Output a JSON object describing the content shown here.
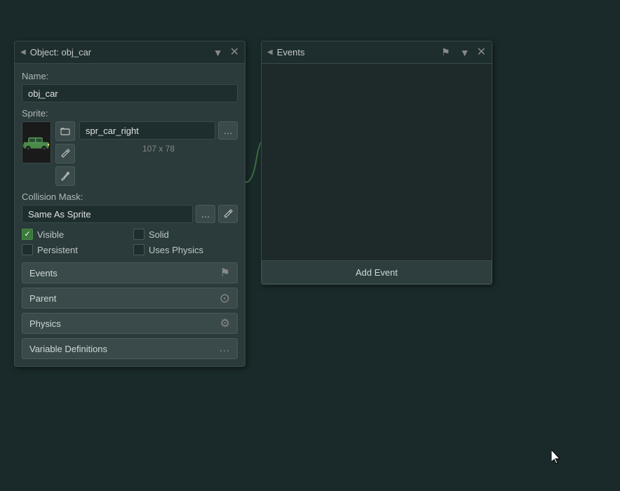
{
  "object_panel": {
    "title": "Object: obj_car",
    "name_label": "Name:",
    "name_value": "obj_car",
    "sprite_label": "Sprite:",
    "sprite_name": "spr_car_right",
    "sprite_size": "107 x 78",
    "collision_label": "Collision Mask:",
    "collision_value": "Same As Sprite",
    "checkboxes": [
      {
        "id": "visible",
        "label": "Visible",
        "checked": true
      },
      {
        "id": "solid",
        "label": "Solid",
        "checked": false
      },
      {
        "id": "persistent",
        "label": "Persistent",
        "checked": false
      },
      {
        "id": "uses_physics",
        "label": "Uses Physics",
        "checked": false
      }
    ],
    "buttons": [
      {
        "id": "events",
        "label": "Events",
        "icon": "⚑"
      },
      {
        "id": "parent",
        "label": "Parent",
        "icon": "⊙"
      },
      {
        "id": "physics",
        "label": "Physics",
        "icon": "⚙"
      },
      {
        "id": "variable_definitions",
        "label": "Variable Definitions",
        "icon": "…"
      }
    ]
  },
  "events_panel": {
    "title": "Events",
    "add_event_label": "Add Event"
  },
  "icons": {
    "panel_arrow": "◀",
    "close": "✕",
    "browse": "📁",
    "edit_pencil": "✏",
    "paint_brush": "🖌",
    "dots": "…",
    "mask_edit": "✏",
    "flag": "⚑",
    "gear": "⚙",
    "parent_icon": "⊙"
  }
}
